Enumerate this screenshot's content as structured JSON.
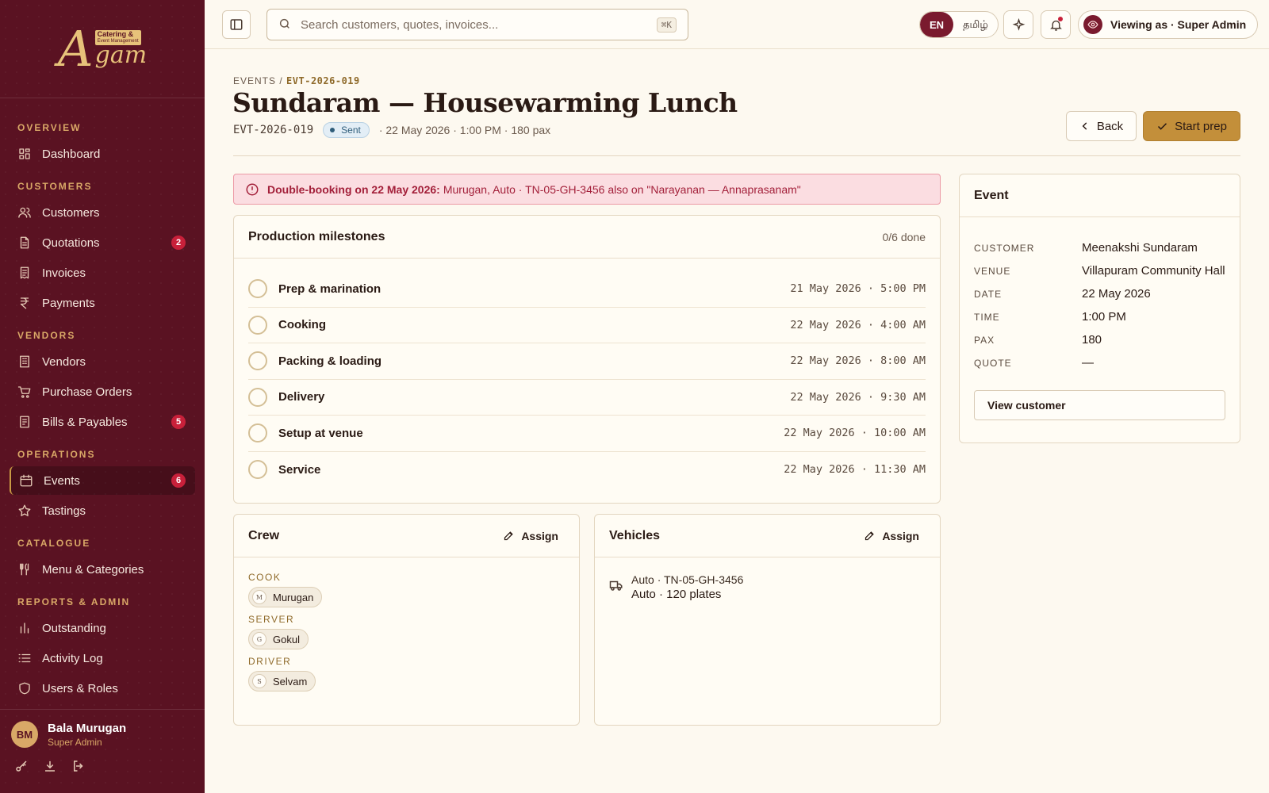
{
  "sidebar": {
    "logo": {
      "mark": "A",
      "badge_line1": "Catering &",
      "badge_line2": "Event Management",
      "word": "gam"
    },
    "sections": [
      {
        "label": "OVERVIEW",
        "items": [
          {
            "label": "Dashboard",
            "icon": "grid-icon"
          }
        ]
      },
      {
        "label": "CUSTOMERS",
        "items": [
          {
            "label": "Customers",
            "icon": "users-icon"
          },
          {
            "label": "Quotations",
            "icon": "file-icon",
            "badge": "2"
          },
          {
            "label": "Invoices",
            "icon": "receipt-icon"
          },
          {
            "label": "Payments",
            "icon": "rupee-icon"
          }
        ]
      },
      {
        "label": "VENDORS",
        "items": [
          {
            "label": "Vendors",
            "icon": "building-icon"
          },
          {
            "label": "Purchase Orders",
            "icon": "cart-icon"
          },
          {
            "label": "Bills & Payables",
            "icon": "bill-icon",
            "badge": "5"
          }
        ]
      },
      {
        "label": "OPERATIONS",
        "items": [
          {
            "label": "Events",
            "icon": "calendar-icon",
            "badge": "6",
            "active": true
          },
          {
            "label": "Tastings",
            "icon": "star-icon"
          }
        ]
      },
      {
        "label": "CATALOGUE",
        "items": [
          {
            "label": "Menu & Categories",
            "icon": "utensils-icon"
          }
        ]
      },
      {
        "label": "REPORTS & ADMIN",
        "items": [
          {
            "label": "Outstanding",
            "icon": "bar-chart-icon"
          },
          {
            "label": "Activity Log",
            "icon": "list-icon"
          },
          {
            "label": "Users & Roles",
            "icon": "shield-icon"
          }
        ]
      }
    ],
    "user": {
      "initials": "BM",
      "name": "Bala Murugan",
      "role": "Super Admin"
    }
  },
  "topbar": {
    "search_placeholder": "Search customers, quotes, invoices...",
    "shortcut": "⌘K",
    "lang_en": "EN",
    "lang_ta": "தமிழ்",
    "viewing_as": "Viewing as · Super Admin"
  },
  "header": {
    "crumb_root": "EVENTS",
    "crumb_sep": "/",
    "crumb_code": "EVT-2026-019",
    "title": "Sundaram — Housewarming Lunch",
    "code": "EVT-2026-019",
    "status": "Sent",
    "details": "· 22 May 2026 · 1:00 PM · 180 pax",
    "back_label": "Back",
    "start_label": "Start prep"
  },
  "alert": {
    "bold": "Double-booking on 22 May 2026:",
    "text": "Murugan, Auto · TN-05-GH-3456 also on \"Narayanan — Annaprasanam\""
  },
  "milestones": {
    "title": "Production milestones",
    "progress": "0/6 done",
    "items": [
      {
        "label": "Prep & marination",
        "time": "21 May 2026 · 5:00 PM",
        "done": false
      },
      {
        "label": "Cooking",
        "time": "22 May 2026 · 4:00 AM",
        "done": false
      },
      {
        "label": "Packing & loading",
        "time": "22 May 2026 · 8:00 AM",
        "done": false
      },
      {
        "label": "Delivery",
        "time": "22 May 2026 · 9:30 AM",
        "done": false
      },
      {
        "label": "Setup at venue",
        "time": "22 May 2026 · 10:00 AM",
        "done": false
      },
      {
        "label": "Service",
        "time": "22 May 2026 · 11:30 AM",
        "done": false
      }
    ]
  },
  "crew": {
    "title": "Crew",
    "assign": "Assign",
    "roles": [
      {
        "role": "COOK",
        "name": "Murugan",
        "initial": "M"
      },
      {
        "role": "SERVER",
        "name": "Gokul",
        "initial": "G"
      },
      {
        "role": "DRIVER",
        "name": "Selvam",
        "initial": "S"
      }
    ]
  },
  "vehicles": {
    "title": "Vehicles",
    "assign": "Assign",
    "line1": "Auto · TN-05-GH-3456",
    "line2": "Auto · 120 plates"
  },
  "event": {
    "title": "Event",
    "rows": [
      {
        "k": "CUSTOMER",
        "v": "Meenakshi Sundaram"
      },
      {
        "k": "VENUE",
        "v": "Villapuram Community Hall"
      },
      {
        "k": "DATE",
        "v": "22 May 2026"
      },
      {
        "k": "TIME",
        "v": "1:00 PM"
      },
      {
        "k": "PAX",
        "v": "180"
      },
      {
        "k": "QUOTE",
        "v": "—"
      }
    ],
    "view_customer": "View customer"
  }
}
